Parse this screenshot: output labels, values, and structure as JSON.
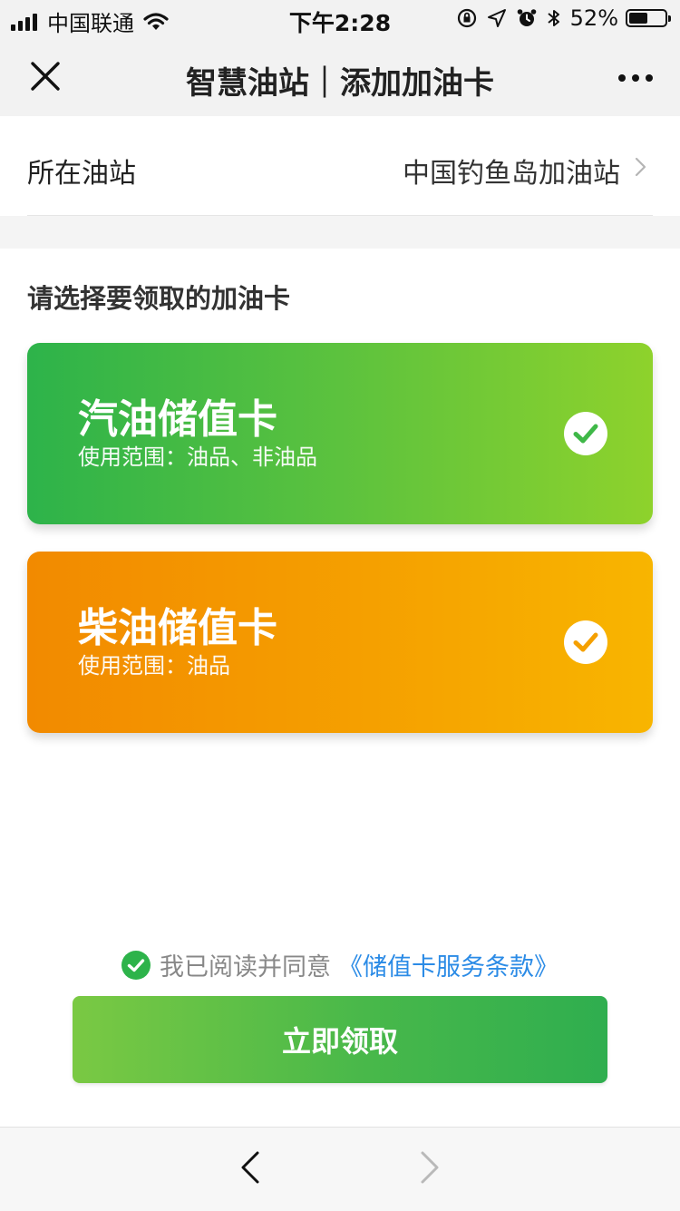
{
  "status_bar": {
    "carrier": "中国联通",
    "time": "下午2:28",
    "battery_percent": "52%",
    "battery_level": 0.52
  },
  "nav": {
    "title": "智慧油站｜添加加油卡"
  },
  "station": {
    "label": "所在油站",
    "value": "中国钓鱼岛加油站"
  },
  "section_title": "请选择要领取的加油卡",
  "cards": [
    {
      "title": "汽油储值卡",
      "scope": "使用范围：油品、非油品",
      "selected": true,
      "color_from": "#2db34a",
      "color_to": "#8ed22c"
    },
    {
      "title": "柴油储值卡",
      "scope": "使用范围：油品",
      "selected": true,
      "color_from": "#f28a00",
      "color_to": "#f8b500"
    }
  ],
  "agreement": {
    "text": "我已阅读并同意",
    "link": "《储值卡服务条款》",
    "checked": true,
    "link_color": "#2b8be6"
  },
  "claim_button_label": "立即领取"
}
